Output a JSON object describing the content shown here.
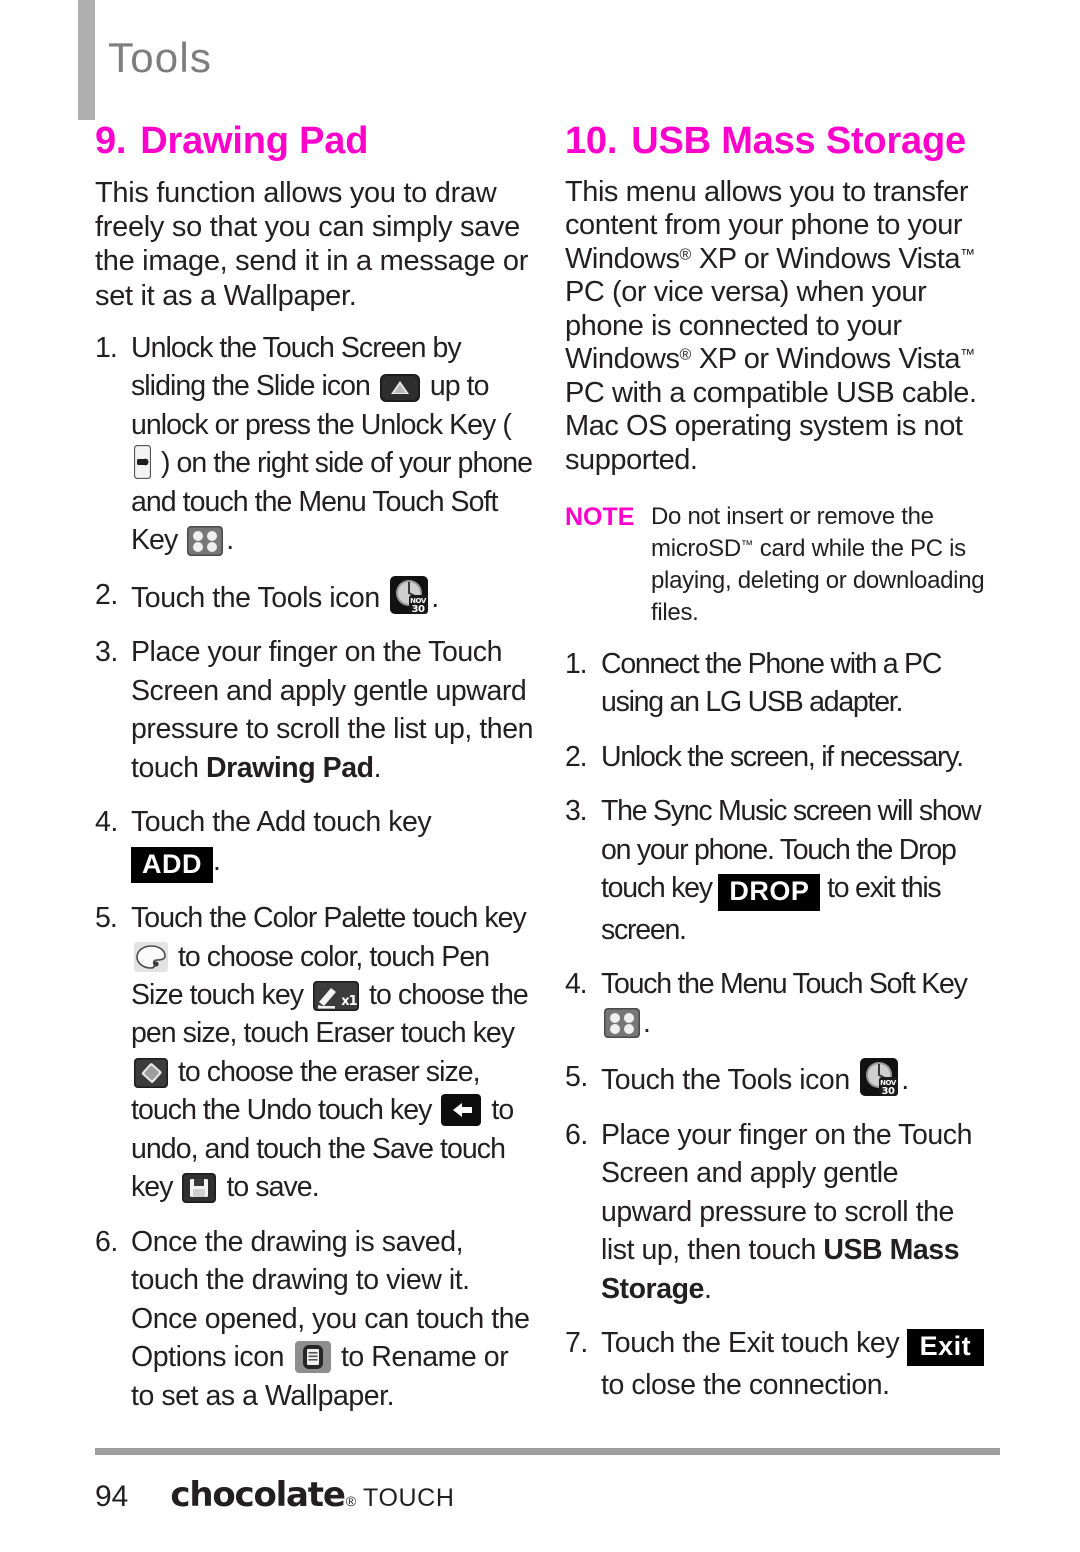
{
  "header": {
    "title": "Tools"
  },
  "left": {
    "section": {
      "number": "9.",
      "title": "Drawing Pad"
    },
    "intro": "This function allows you to draw freely so that you can simply save the image, send it in a message or set it as a Wallpaper.",
    "steps": [
      {
        "marker": "1.",
        "a": "Unlock the Touch Screen by sliding the Slide icon",
        "b": "up to unlock or press the Unlock Key (",
        "c": ") on the right side of your phone and touch the Menu Touch Soft Key",
        "d": "."
      },
      {
        "marker": "2.",
        "a": "Touch the Tools icon",
        "b": "."
      },
      {
        "marker": "3.",
        "a": "Place your finger on the Touch Screen and apply gentle upward pressure to scroll the list up, then touch ",
        "bold": "Drawing Pad",
        "b": "."
      },
      {
        "marker": "4.",
        "a": "Touch the Add touch key",
        "key": "ADD",
        "b": "."
      },
      {
        "marker": "5.",
        "a": "Touch the Color Palette touch key",
        "b": "to choose color, touch Pen Size touch key",
        "c": "to choose the pen size, touch Eraser touch key",
        "d": "to choose the eraser size, touch the Undo touch key",
        "e": "to undo, and touch the Save touch key",
        "f": "to save."
      },
      {
        "marker": "6.",
        "a": "Once the drawing is saved, touch the drawing to view it. Once opened, you can touch the Options icon",
        "b": "to Rename or to set as a Wallpaper."
      }
    ]
  },
  "right": {
    "section": {
      "number": "10.",
      "title": "USB Mass Storage"
    },
    "intro": {
      "p1": "This menu allows you to transfer content from your phone to your Windows",
      "reg1": "®",
      "p2": " XP or Windows Vista",
      "tm1": "™",
      "p3": " PC (or vice versa) when your phone is connected to your Windows",
      "reg2": "®",
      "p4": " XP or Windows Vista",
      "tm2": "™",
      "p5": " PC with a compatible USB cable. Mac OS operating system is not supported."
    },
    "note": {
      "label": "NOTE",
      "t1": "Do not insert or remove the microSD",
      "tm": "™",
      "t2": " card while the PC is playing, deleting or downloading files."
    },
    "steps": [
      {
        "marker": "1.",
        "a": "Connect the Phone with a PC using an LG USB adapter."
      },
      {
        "marker": "2.",
        "a": "Unlock the screen, if necessary."
      },
      {
        "marker": "3.",
        "a": "The Sync Music screen will show on your phone. Touch the Drop touch key",
        "key": "DROP",
        "b": "to exit this screen."
      },
      {
        "marker": "4.",
        "a": "Touch the Menu Touch Soft Key",
        "b": "."
      },
      {
        "marker": "5.",
        "a": "Touch the Tools icon",
        "b": "."
      },
      {
        "marker": "6.",
        "a": "Place your finger on the Touch Screen and apply gentle upward pressure to scroll the list up, then touch ",
        "bold": "USB Mass Storage",
        "b": "."
      },
      {
        "marker": "7.",
        "a": "Touch the Exit touch key",
        "key": "Exit",
        "b": "to close the connection."
      }
    ]
  },
  "footer": {
    "page_number": "94",
    "brand": "chocolate",
    "brand_reg": "®",
    "brand_suffix": "TOUCH"
  },
  "icons": {
    "slide": "slide-icon",
    "unlock_key": "unlock-key-icon",
    "menu_soft_key": "menu-touch-soft-key-icon",
    "tools": "tools-icon",
    "color_palette": "color-palette-icon",
    "pen_size": "pen-size-icon",
    "eraser": "eraser-icon",
    "undo": "undo-icon",
    "save": "save-icon",
    "options": "options-icon"
  },
  "colors": {
    "accent": "#ff00cc",
    "header_gray": "#7d7d7d",
    "bar_gray": "#b0b0b0",
    "rule_gray": "#9d9d9d",
    "text": "#231f20"
  }
}
